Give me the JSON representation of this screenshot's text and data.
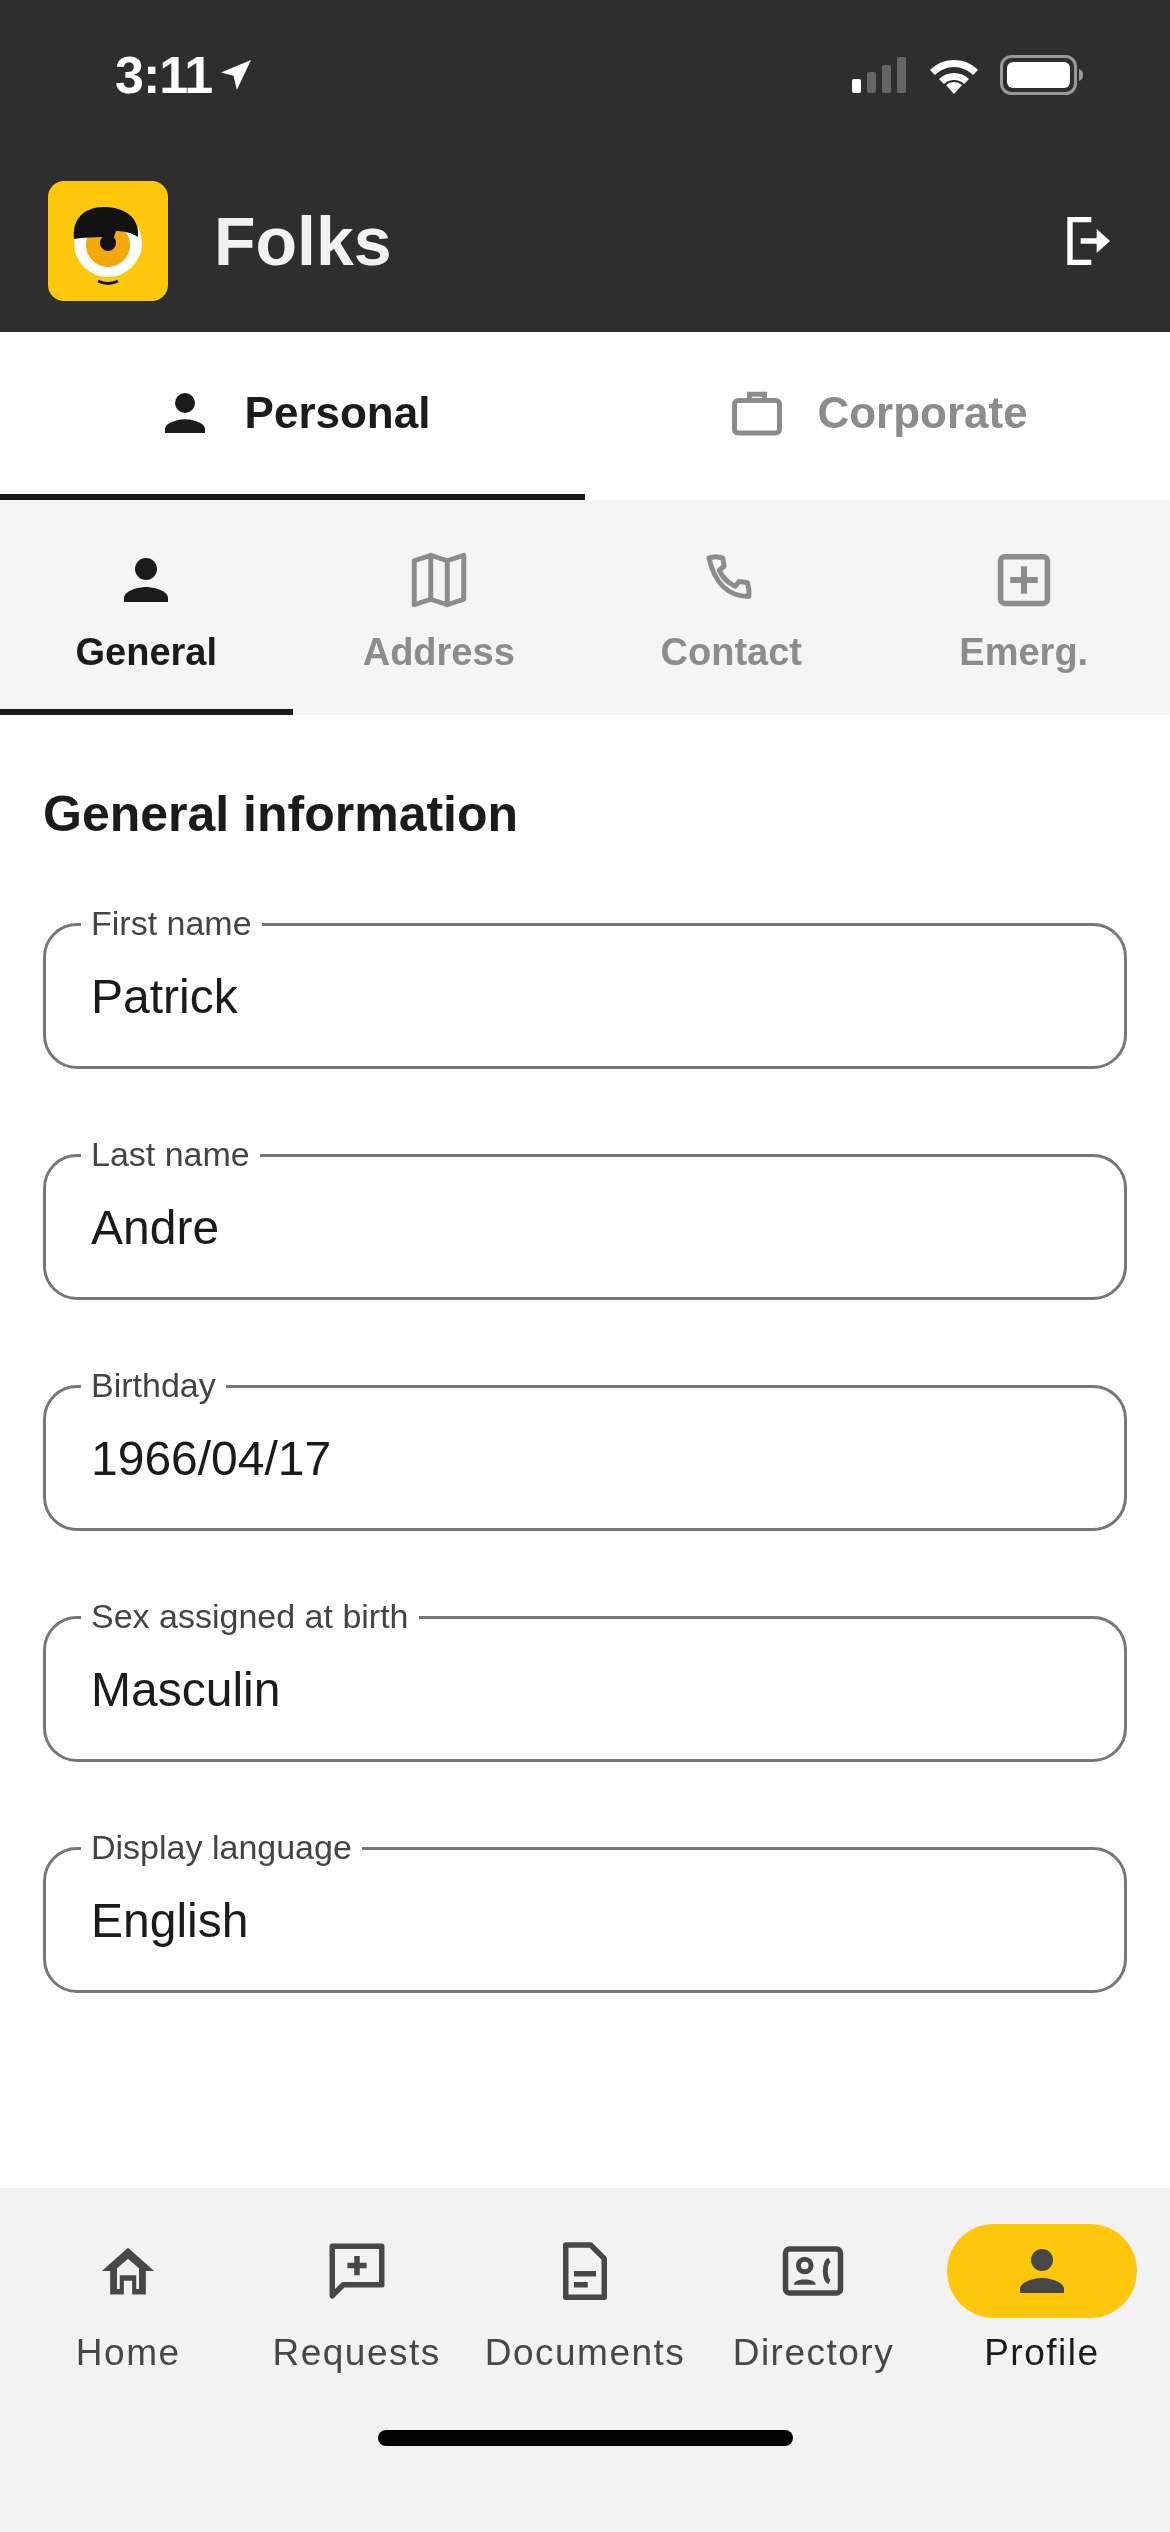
{
  "status_bar": {
    "time": "3:11"
  },
  "app_bar": {
    "title": "Folks"
  },
  "tabs": [
    {
      "label": "Personal",
      "selected": true
    },
    {
      "label": "Corporate",
      "selected": false
    }
  ],
  "sub_tabs": [
    {
      "label": "General",
      "selected": true
    },
    {
      "label": "Address",
      "selected": false
    },
    {
      "label": "Contact",
      "selected": false
    },
    {
      "label": "Emerg.",
      "selected": false
    }
  ],
  "section_title": "General information",
  "fields": [
    {
      "label": "First name",
      "value": "Patrick"
    },
    {
      "label": "Last name",
      "value": "Andre"
    },
    {
      "label": "Birthday",
      "value": "1966/04/17"
    },
    {
      "label": "Sex assigned at birth",
      "value": "Masculin"
    },
    {
      "label": "Display language",
      "value": "English"
    }
  ],
  "bottom_nav": [
    {
      "label": "Home",
      "selected": false
    },
    {
      "label": "Requests",
      "selected": false
    },
    {
      "label": "Documents",
      "selected": false
    },
    {
      "label": "Directory",
      "selected": false
    },
    {
      "label": "Profile",
      "selected": true
    }
  ]
}
